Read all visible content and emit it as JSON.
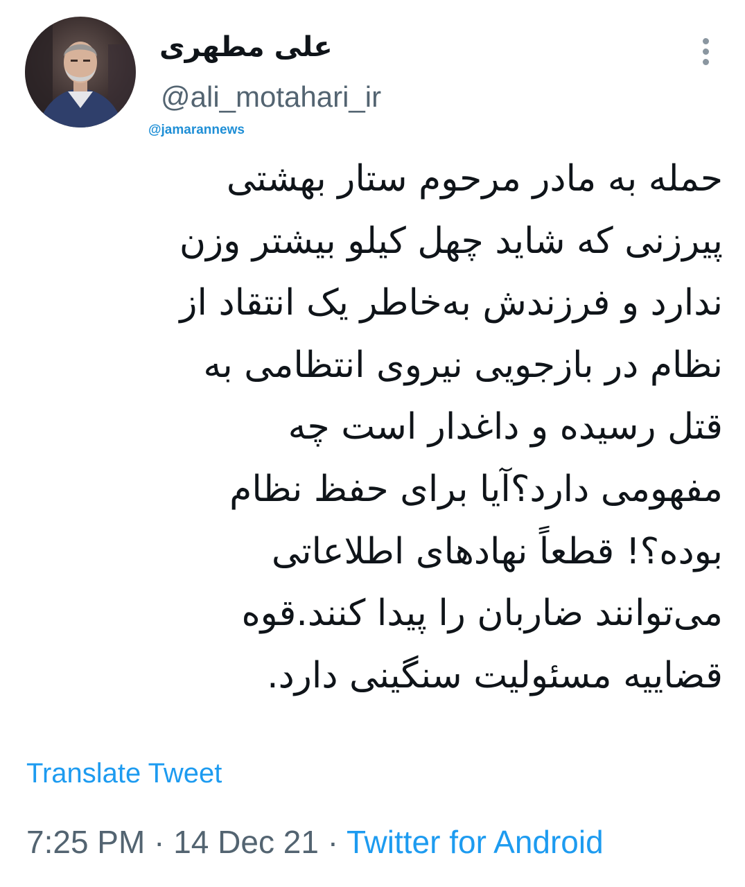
{
  "tweet": {
    "display_name": "علی مطهری",
    "handle": "@ali_motahari_ir",
    "watermark": "@jamarannews",
    "more_icon": "more-vertical-icon",
    "body_lines": [
      "حمله به مادر مرحوم ستار بهشتی",
      "پیرزنی که شاید چهل کیلو بیشتر وزن",
      "ندارد و فرزندش به‌خاطر یک انتقاد از",
      "نظام در بازجویی نیروی انتظامی به",
      "قتل رسیده و داغدار است چه",
      "مفهومی دارد؟آیا برای حفظ نظام",
      "بوده؟! قطعاً نهادهای اطلاعاتی",
      "می‌توانند ضاربان را پیدا کنند.قوه",
      "قضاییه مسئولیت سنگینی دارد."
    ],
    "translate_label": "Translate Tweet",
    "time": "7:25 PM",
    "separator": "·",
    "date": "14 Dec 21",
    "source": "Twitter for Android"
  },
  "colors": {
    "text_primary": "#0f1419",
    "text_secondary": "#536471",
    "link": "#1d9bf0",
    "watermark": "#1f8fd6",
    "background": "#ffffff"
  }
}
